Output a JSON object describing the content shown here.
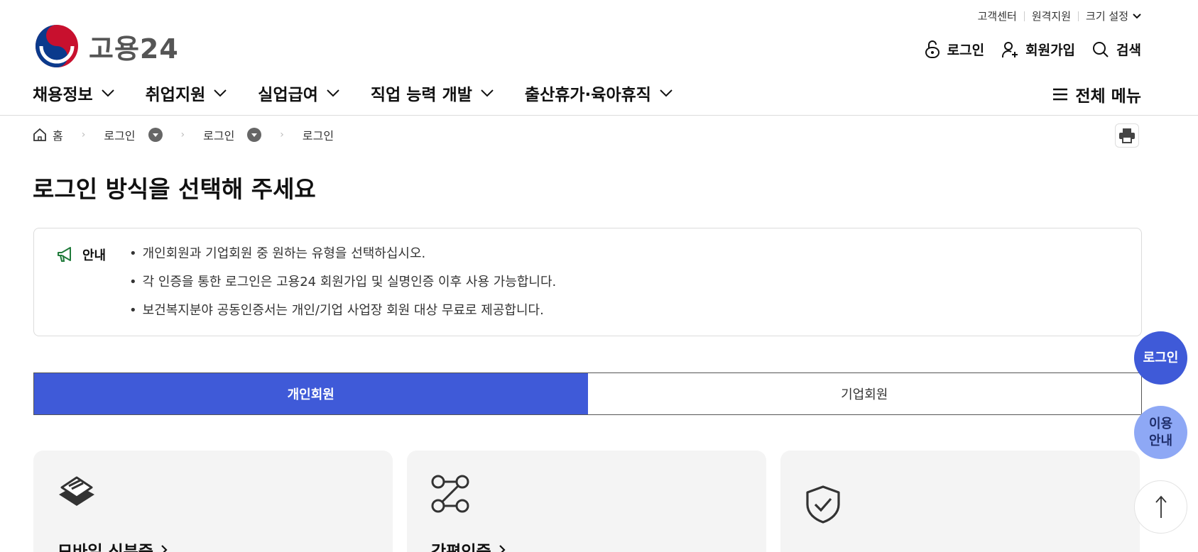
{
  "header": {
    "logo_text": "고용24",
    "utility": [
      "고객센터",
      "원격지원",
      "크기 설정"
    ],
    "actions": {
      "login": "로그인",
      "signup": "회원가입",
      "search": "검색"
    },
    "nav": [
      "채용정보",
      "취업지원",
      "실업급여",
      "직업 능력 개발",
      "출산휴가·육아휴직"
    ],
    "all_menu": "전체 메뉴"
  },
  "breadcrumb": {
    "home": "홈",
    "level1": "로그인",
    "level2": "로그인",
    "current": "로그인"
  },
  "page_title": "로그인 방식을 선택해 주세요",
  "notice": {
    "label": "안내",
    "items": [
      "개인회원과 기업회원 중 원하는 유형을 선택하십시오.",
      "각 인증을 통한 로그인은 고용24 회원가입 및 실명인증 이후 사용 가능합니다.",
      "보건복지분야 공동인증서는 개인/기업 사업장 회원 대상 무료로 제공합니다."
    ]
  },
  "tabs": {
    "personal": "개인회원",
    "business": "기업회원",
    "active": "personal"
  },
  "cards": [
    {
      "title": "모바일 신분증",
      "icon": "layers-icon"
    },
    {
      "title": "간편인증",
      "icon": "nodes-icon"
    },
    {
      "title": "",
      "icon": "shield-check-icon"
    }
  ],
  "floating": {
    "login": "로그인",
    "guide_line1": "이용",
    "guide_line2": "안내",
    "top": "↑"
  },
  "colors": {
    "primary": "#3f5ad8",
    "secondary": "#8ea8f5",
    "notice_icon": "#1f7a3a"
  }
}
